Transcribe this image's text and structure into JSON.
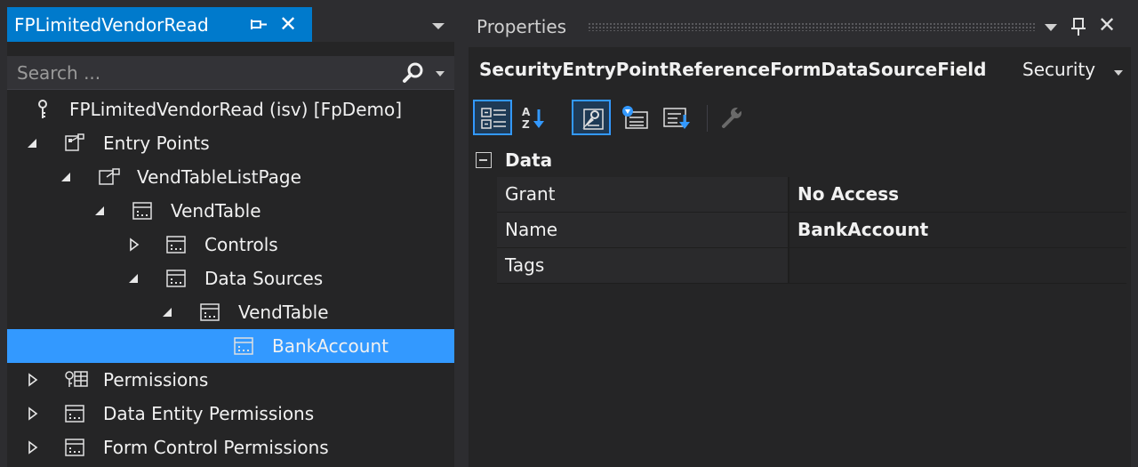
{
  "solution_panel": {
    "tab": {
      "title": "FPLimitedVendorRead"
    },
    "search": {
      "placeholder": "Search ..."
    },
    "tree": [
      {
        "label": "FPLimitedVendorRead (isv) [FpDemo]",
        "icon": "key-icon",
        "level": 0,
        "expander": "none"
      },
      {
        "label": "Entry Points",
        "icon": "entry-points-icon",
        "level": 0,
        "expander": "expanded"
      },
      {
        "label": "VendTableListPage",
        "icon": "entry-point-icon",
        "level": 1,
        "expander": "expanded"
      },
      {
        "label": "VendTable",
        "icon": "form-icon",
        "level": 2,
        "expander": "expanded"
      },
      {
        "label": "Controls",
        "icon": "form-icon",
        "level": 3,
        "expander": "collapsed"
      },
      {
        "label": "Data Sources",
        "icon": "form-icon",
        "level": 3,
        "expander": "expanded"
      },
      {
        "label": "VendTable",
        "icon": "form-icon",
        "level": 4,
        "expander": "expanded"
      },
      {
        "label": "BankAccount",
        "icon": "form-icon",
        "level": 5,
        "expander": "none",
        "selected": true
      },
      {
        "label": "Permissions",
        "icon": "permissions-icon",
        "level": 0,
        "expander": "collapsed"
      },
      {
        "label": "Data Entity Permissions",
        "icon": "form-icon",
        "level": 0,
        "expander": "collapsed"
      },
      {
        "label": "Form Control Permissions",
        "icon": "form-icon",
        "level": 0,
        "expander": "collapsed"
      }
    ]
  },
  "properties_panel": {
    "title": "Properties",
    "object_name": "SecurityEntryPointReferenceFormDataSourceField",
    "object_kind": "Security",
    "toolbar": [
      {
        "name": "categorized-button",
        "icon": "categorized-icon",
        "active": true
      },
      {
        "name": "alphabetical-button",
        "icon": "sort-az-icon",
        "active": false
      },
      {
        "name": "properties-view-button",
        "icon": "properties-icon",
        "active": true
      },
      {
        "name": "events-button",
        "icon": "events-icon",
        "active": false
      },
      {
        "name": "property-pages-button",
        "icon": "property-pages-icon",
        "active": false
      },
      {
        "name": "settings-button",
        "icon": "wrench-icon",
        "active": false
      }
    ],
    "category": {
      "label": "Data",
      "rows": [
        {
          "name": "Grant",
          "value": "No Access"
        },
        {
          "name": "Name",
          "value": "BankAccount"
        },
        {
          "name": "Tags",
          "value": ""
        }
      ]
    }
  },
  "colors": {
    "accent": "#007acc",
    "selection": "#3399ff",
    "panel_bg": "#252526",
    "chrome_bg": "#2d2d30",
    "text": "#f1f1f1"
  }
}
